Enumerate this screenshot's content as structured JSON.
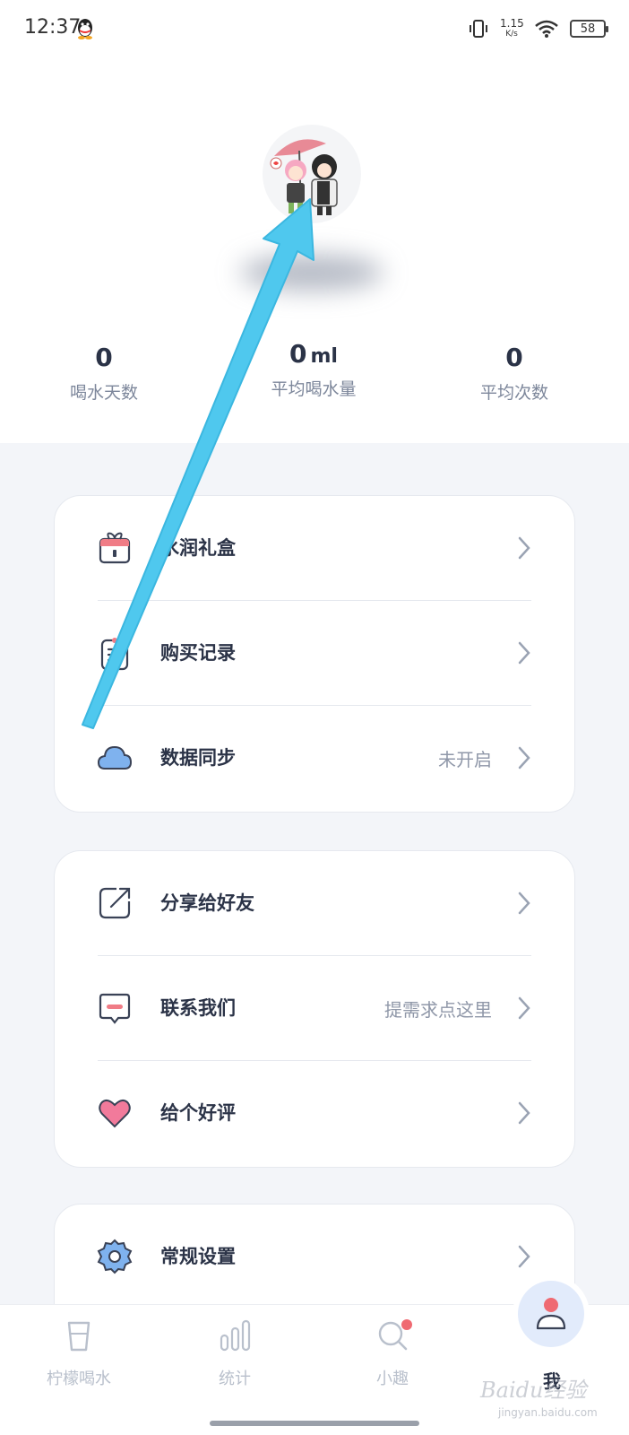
{
  "status_bar": {
    "time": "12:37",
    "net_speed_value": "1.15",
    "net_speed_unit": "K/s",
    "battery": "58"
  },
  "stats": {
    "days_value": "0",
    "days_label": "喝水天数",
    "avg_volume_value": "0",
    "avg_volume_unit": "ml",
    "avg_volume_label": "平均喝水量",
    "avg_times_value": "0",
    "avg_times_label": "平均次数"
  },
  "card1": {
    "gift_label": "水润礼盒",
    "purchase_label": "购买记录",
    "sync_label": "数据同步",
    "sync_value": "未开启"
  },
  "card2": {
    "share_label": "分享给好友",
    "contact_label": "联系我们",
    "contact_value": "提需求点这里",
    "rate_label": "给个好评"
  },
  "card3": {
    "settings_label": "常规设置"
  },
  "nav": {
    "water_label": "柠檬喝水",
    "stats_label": "统计",
    "fun_label": "小趣",
    "me_label": "我"
  },
  "watermark": {
    "text": "Baidu经验",
    "sub": "jingyan.baidu.com"
  },
  "colors": {
    "accent_blue": "#4fc8ee",
    "heart_pink": "#f27a9b",
    "cloud_blue": "#7fb2ee",
    "badge_red": "#ef6a72"
  },
  "icons": [
    "qq-icon",
    "vibrate-icon",
    "wifi-icon",
    "gift-icon",
    "clipboard-icon",
    "cloud-icon",
    "share-icon",
    "message-icon",
    "heart-icon",
    "gear-icon",
    "cup-icon",
    "bar-chart-icon",
    "search-icon",
    "user-icon",
    "chevron-right-icon"
  ]
}
